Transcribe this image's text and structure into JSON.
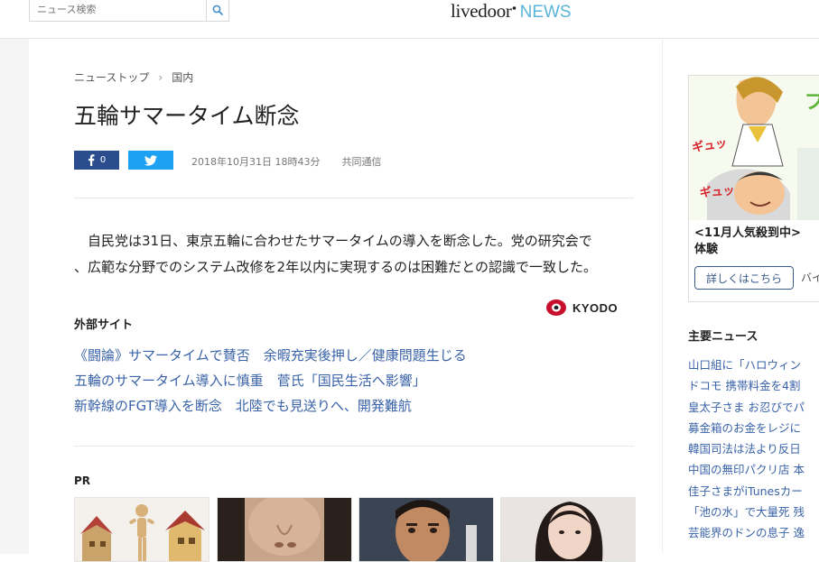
{
  "header": {
    "search_placeholder": "ニュース検索",
    "logo_main": "livedoor",
    "logo_news": "NEWS"
  },
  "article": {
    "breadcrumb": [
      "ニューストップ",
      "国内"
    ],
    "title": "五輪サマータイム断念",
    "fb_count": "0",
    "date": "2018年10月31日 18時43分",
    "source": "共同通信",
    "body_line1": "　自民党は31日、東京五輪に合わせたサマータイムの導入を断念した。党の研究会で",
    "body_line2": "、広範な分野でのシステム改修を2年以内に実現するのは困難だとの認識で一致した。",
    "publisher_logo": "KYODO"
  },
  "external": {
    "heading": "外部サイト",
    "links": [
      "《闘論》サマータイムで賛否　余暇充実後押し／健康問題生じる",
      "五輪のサマータイム導入に慎重　菅氏「国民生活へ影響」",
      "新幹線のFGT導入を断念　北陸でも見送りへ、開発難航"
    ]
  },
  "pr": {
    "label": "PR"
  },
  "sidebar": {
    "ad_title_line1": "<11月人気殺到中>",
    "ad_title_line2": "体験",
    "ad_button": "詳しくはこちら",
    "ad_extra": "バイ",
    "ad_art_text1": "ギュッ",
    "ad_art_text2": "ギュッ",
    "ad_art_text3": "プ",
    "news_heading": "主要ニュース",
    "news": [
      "山口組に「ハロウィン",
      "ドコモ 携帯料金を4割",
      "皇太子さま お忍びでパ",
      "募金箱のお金をレジに",
      "韓国司法は法より反日",
      "中国の無印パクリ店 本",
      "佳子さまがiTunesカー",
      "「池の水」で大量死 残",
      "芸能界のドンの息子 逸"
    ]
  },
  "colors": {
    "facebook": "#2b4d8d",
    "twitter": "#1da1f2",
    "link": "#3a63a8",
    "logo_news": "#5bb5d8",
    "kyodo_red": "#c8102e"
  }
}
